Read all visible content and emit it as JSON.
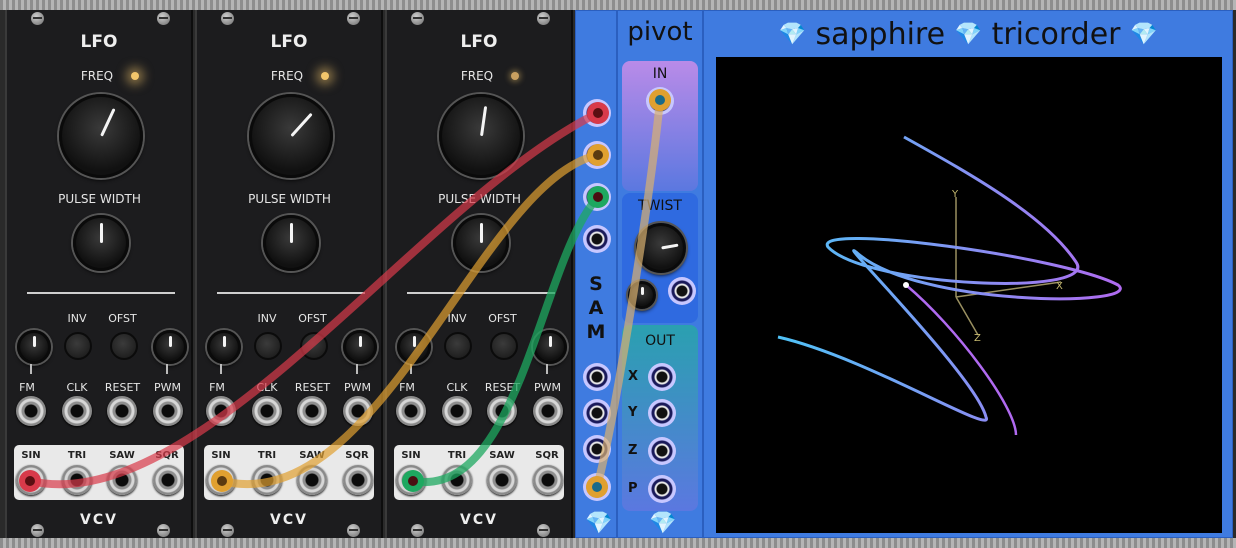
{
  "lfo": {
    "title": "LFO",
    "freq_label": "FREQ",
    "pw_label": "PULSE WIDTH",
    "inv_label": "INV",
    "ofst_label": "OFST",
    "fm_label": "FM",
    "clk_label": "CLK",
    "reset_label": "RESET",
    "pwm_label": "PWM",
    "sin_label": "SIN",
    "tri_label": "TRI",
    "saw_label": "SAW",
    "sqr_label": "SQR",
    "brand": "VCV"
  },
  "sam": {
    "letters": [
      "S",
      "A",
      "M"
    ]
  },
  "pivot": {
    "title": "pivot",
    "in_label": "IN",
    "twist_label": "TWIST",
    "out_label": "OUT",
    "axes": [
      "X",
      "Y",
      "Z",
      "P"
    ]
  },
  "tricorder": {
    "title_left": "sapphire",
    "title_right": "tricorder",
    "axis_labels": {
      "y": "Y",
      "x": "X",
      "z": "Z"
    }
  },
  "colors": {
    "cable_red": "#d83a4a",
    "cable_orange": "#e0a030",
    "cable_green": "#1ea860",
    "cable_amber": "#d9b070",
    "accent_blue": "#3f7be0"
  },
  "icons": {
    "gem": "sapphire-gem-icon"
  }
}
